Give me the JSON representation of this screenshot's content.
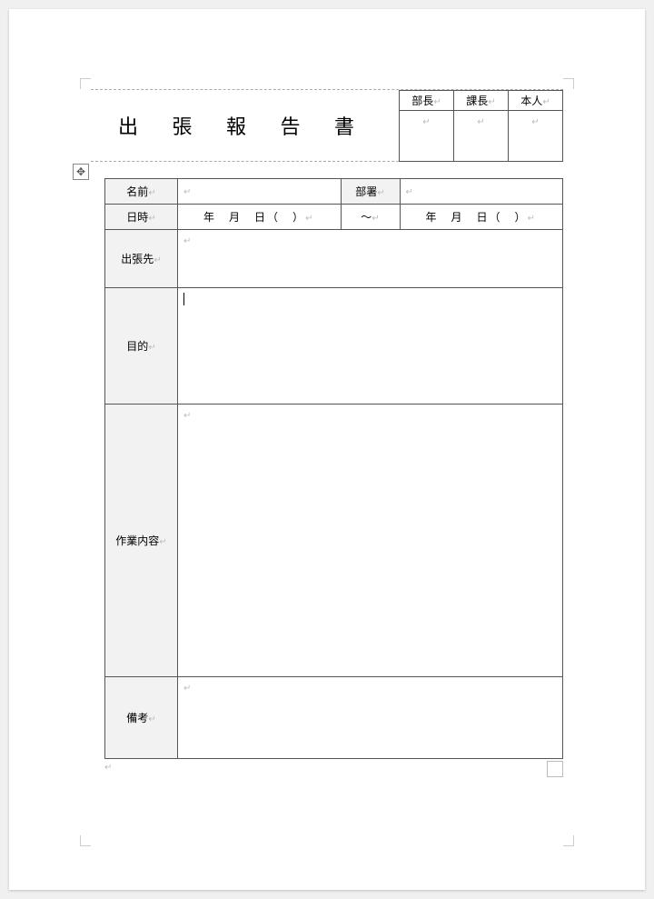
{
  "title": "出 張 報 告 書",
  "approval": {
    "col1": "部長",
    "col2": "課長",
    "col3": "本人"
  },
  "labels": {
    "name": "名前",
    "department": "部署",
    "datetime": "日時",
    "destination": "出張先",
    "purpose": "目的",
    "workContent": "作業内容",
    "notes": "備考"
  },
  "dateTemplate": "年　月　日（　）",
  "dateSeparator": "～",
  "paraMark": "↵",
  "moveIcon": "✥"
}
